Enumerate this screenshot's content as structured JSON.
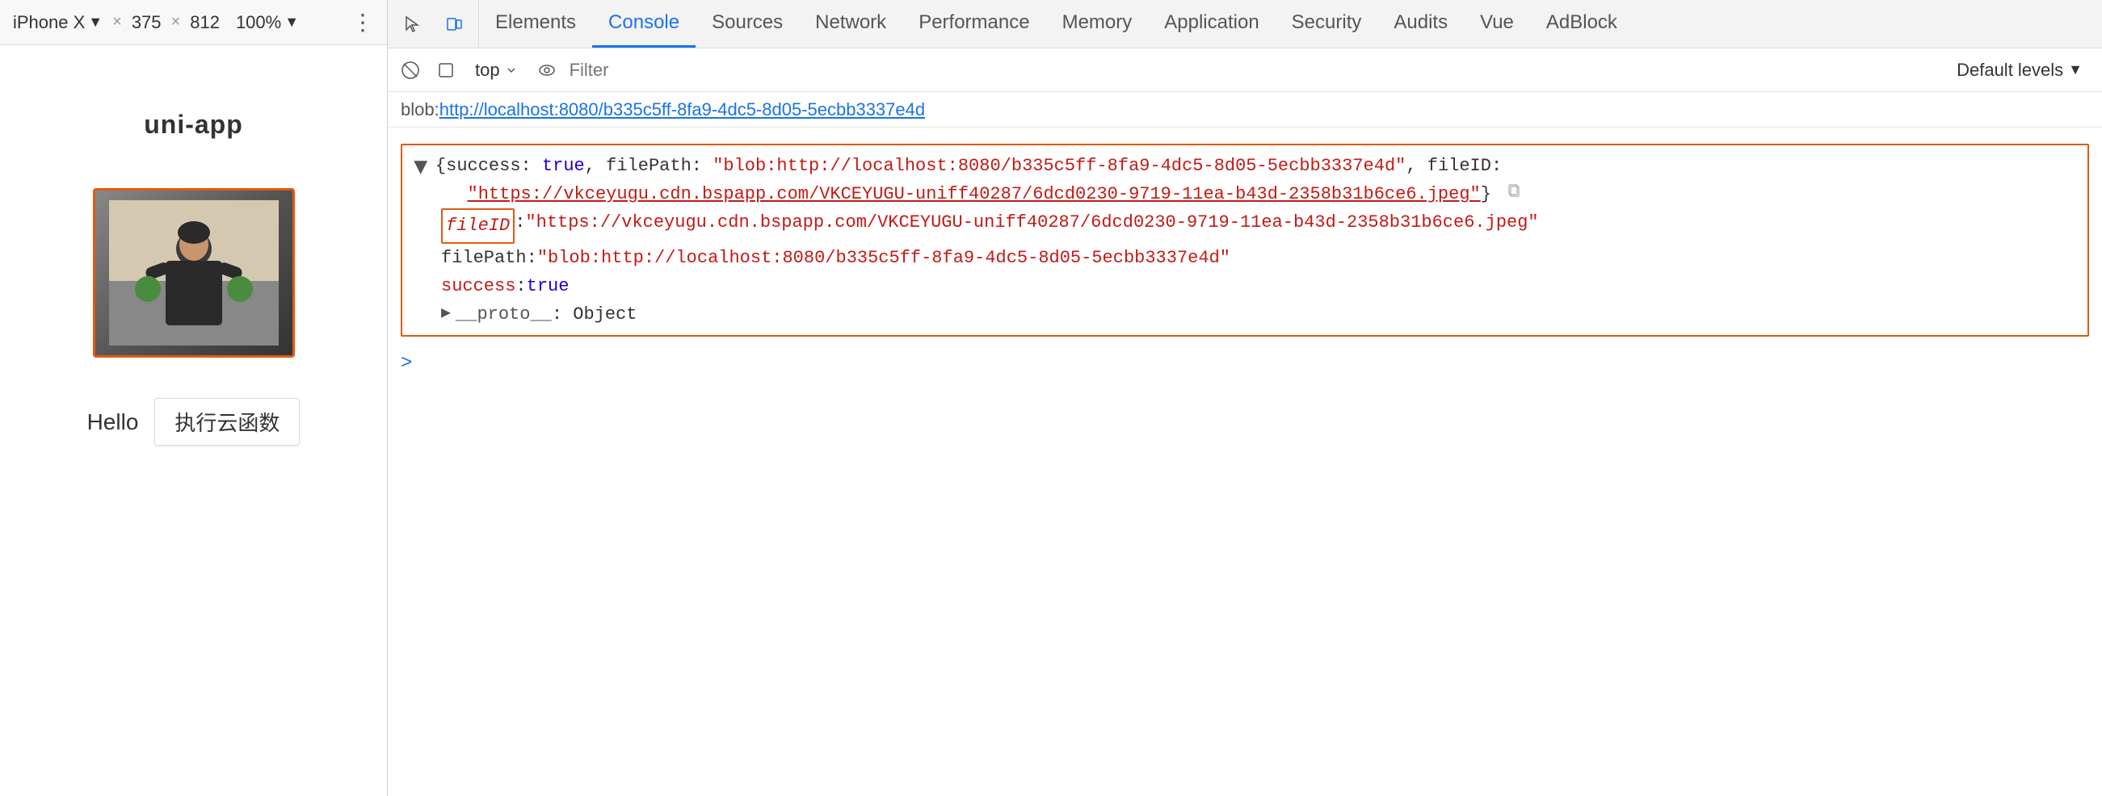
{
  "left_panel": {
    "device_toolbar": {
      "device_name": "iPhone X",
      "chevron": "▼",
      "separator": "×",
      "width": "375",
      "height": "812",
      "zoom": "100%",
      "zoom_chevron": "▼",
      "more_icon": "⋮"
    },
    "app": {
      "title": "uni-app",
      "hello_text": "Hello",
      "cloud_button": "执行云函数"
    }
  },
  "devtools": {
    "tabs": [
      {
        "label": "Elements",
        "active": false
      },
      {
        "label": "Console",
        "active": true
      },
      {
        "label": "Sources",
        "active": false
      },
      {
        "label": "Network",
        "active": false
      },
      {
        "label": "Performance",
        "active": false
      },
      {
        "label": "Memory",
        "active": false
      },
      {
        "label": "Application",
        "active": false
      },
      {
        "label": "Security",
        "active": false
      },
      {
        "label": "Audits",
        "active": false
      },
      {
        "label": "Vue",
        "active": false
      },
      {
        "label": "AdBlock",
        "active": false
      }
    ],
    "console_toolbar": {
      "context": "top",
      "filter_placeholder": "Filter",
      "levels": "Default levels",
      "levels_chevron": "▼"
    },
    "url_bar": {
      "text": "blob:",
      "link_text": "http://localhost:8080/b335c5ff-8fa9-4dc5-8d05-5ecbb3337e4d"
    },
    "console_entry": {
      "line1": "{success: true, filePath: \"blob:http://localhost:8080/b335c5ff-8fa9-4dc5-8d05-5ecbb3337e4d\", fileID:",
      "line1_link": "\"https://vkceyugu.cdn.bspapp.com/VKCEYUGU-uniff40287/6dcd0230-9719-11ea-b43d-2358b31b6ce6.jpeg\"",
      "line1_end": "}",
      "expanded": {
        "fileID_key": "fileID",
        "fileID_value": "\"https://vkceyugu.cdn.bspapp.com/VKCEYUGU-uniff40287/6dcd0230-9719-11ea-b43d-2358b31b6ce6.jpeg\"",
        "filePath_key": "filePath",
        "filePath_value": "\"blob:http://localhost:8080/b335c5ff-8fa9-4dc5-8d05-5ecbb3337e4d\"",
        "success_key": "success",
        "success_value": "true",
        "proto_key": "__proto__",
        "proto_value": "Object"
      }
    }
  }
}
